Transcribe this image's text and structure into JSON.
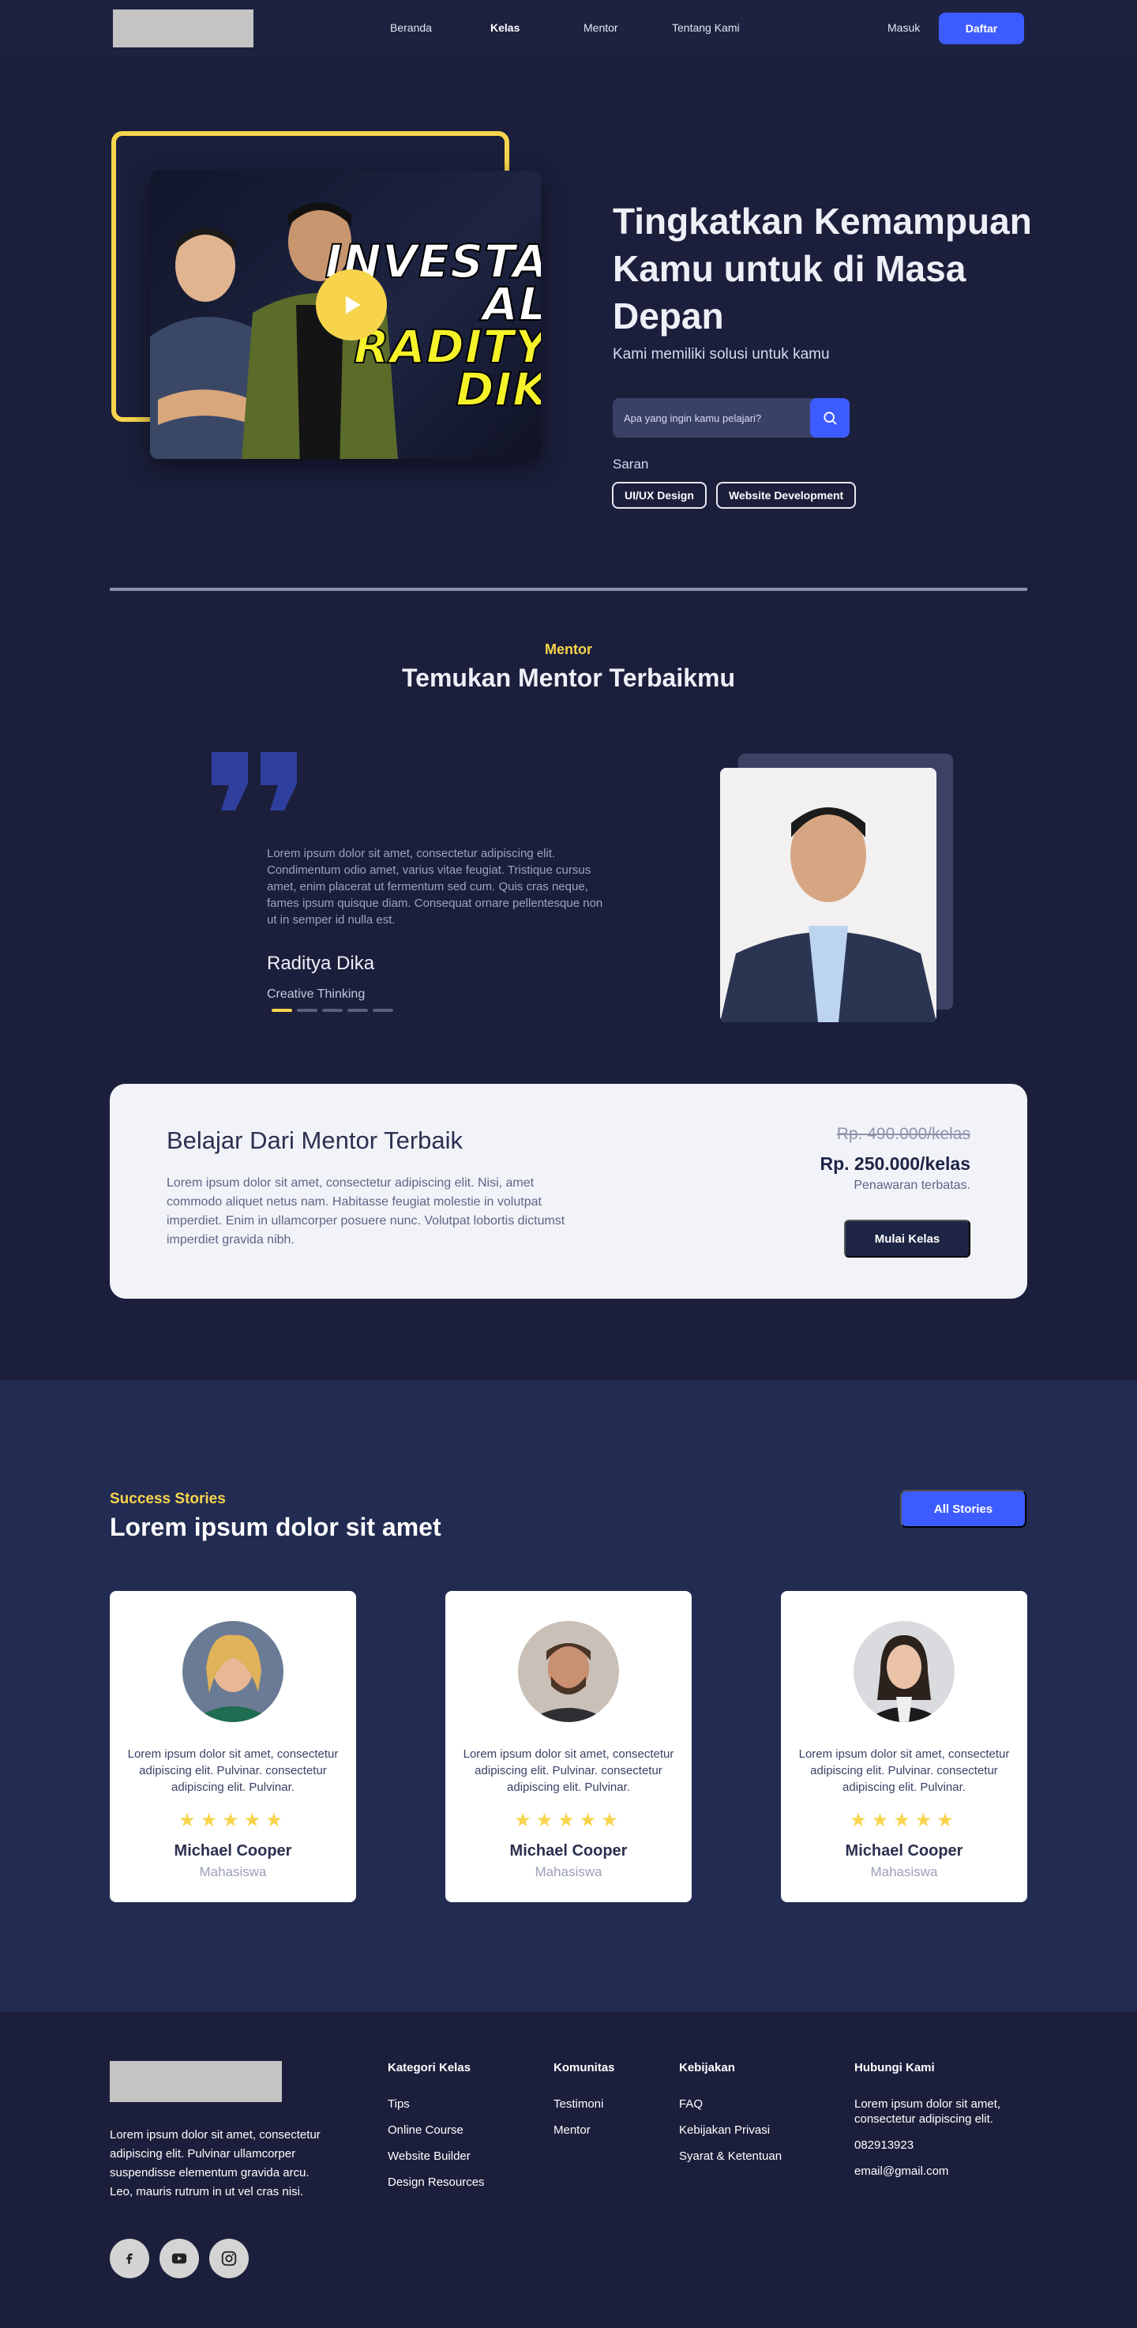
{
  "nav": {
    "links": [
      {
        "label": "Beranda",
        "active": false
      },
      {
        "label": "Kelas",
        "active": true
      },
      {
        "label": "Mentor",
        "active": false
      },
      {
        "label": "Tentang Kami",
        "active": false
      }
    ],
    "login": "Masuk",
    "signup": "Daftar"
  },
  "hero": {
    "title": "Tingkatkan Kemampuan Kamu untuk di Masa Depan",
    "subtitle": "Kami memiliki solusi untuk kamu",
    "search_placeholder": "Apa yang ingin kamu pelajari?",
    "suggestion_label": "Saran",
    "suggestions": [
      "UI/UX Design",
      "Website Development"
    ],
    "video_text": [
      "INVESTA",
      "AL",
      "RADITY",
      "DIK"
    ]
  },
  "mentor": {
    "kicker": "Mentor",
    "title": "Temukan Mentor Terbaikmu",
    "quote": "Lorem ipsum dolor sit amet, consectetur adipiscing elit. Condimentum odio amet, varius vitae feugiat. Tristique cursus amet, enim placerat ut fermentum sed cum. Quis cras neque, fames ipsum quisque diam. Consequat ornare pellentesque non ut in semper id nulla est.",
    "name": "Raditya Dika",
    "role": "Creative Thinking",
    "slides_total": 5,
    "slide_active": 1
  },
  "cta": {
    "title": "Belajar Dari Mentor Terbaik",
    "text": "Lorem ipsum dolor sit amet, consectetur adipiscing elit. Nisi, amet commodo aliquet netus nam. Habitasse feugiat molestie in volutpat imperdiet. Enim in ullamcorper posuere nunc. Volutpat lobortis dictumst imperdiet gravida nibh.",
    "old_price": "Rp. 490.000/kelas",
    "new_price": "Rp. 250.000/kelas",
    "note": "Penawaran terbatas.",
    "button": "Mulai Kelas"
  },
  "stories": {
    "kicker": "Success Stories",
    "title": "Lorem ipsum dolor sit amet",
    "all_button": "All Stories",
    "items": [
      {
        "text": "Lorem ipsum dolor sit amet, consectetur adipiscing elit. Pulvinar. consectetur adipiscing elit. Pulvinar.",
        "rating": 5,
        "stars": "★★★★★",
        "name": "Michael Cooper",
        "role": "Mahasiswa"
      },
      {
        "text": "Lorem ipsum dolor sit amet, consectetur adipiscing elit. Pulvinar. consectetur adipiscing elit. Pulvinar.",
        "rating": 5,
        "stars": "★★★★★",
        "name": "Michael Cooper",
        "role": "Mahasiswa"
      },
      {
        "text": "Lorem ipsum dolor sit amet, consectetur adipiscing elit. Pulvinar. consectetur adipiscing elit. Pulvinar.",
        "rating": 5,
        "stars": "★★★★★",
        "name": "Michael Cooper",
        "role": "Mahasiswa"
      }
    ]
  },
  "footer": {
    "description": "Lorem ipsum dolor sit amet, consectetur adipiscing elit. Pulvinar ullamcorper suspendisse elementum gravida arcu. Leo, mauris rutrum in ut vel cras nisi.",
    "social": [
      "facebook-icon",
      "youtube-icon",
      "instagram-icon"
    ],
    "columns": {
      "kategori": {
        "title": "Kategori Kelas",
        "items": [
          "Tips",
          "Online Course",
          "Website Builder",
          "Design Resources"
        ]
      },
      "komunitas": {
        "title": "Komunitas",
        "items": [
          "Testimoni",
          "Mentor"
        ]
      },
      "kebijakan": {
        "title": "Kebijakan",
        "items": [
          "FAQ",
          "Kebijakan Privasi",
          "Syarat & Ketentuan"
        ]
      },
      "hubungi": {
        "title": "Hubungi Kami",
        "address": "Lorem ipsum dolor sit amet, consectetur adipiscing elit.",
        "phone": "082913923",
        "email": "email@gmail.com"
      }
    }
  },
  "colors": {
    "background": "#1b1f3b",
    "accent": "#3d5cff",
    "highlight": "#f7d44c",
    "stories_bg": "#222b52"
  }
}
